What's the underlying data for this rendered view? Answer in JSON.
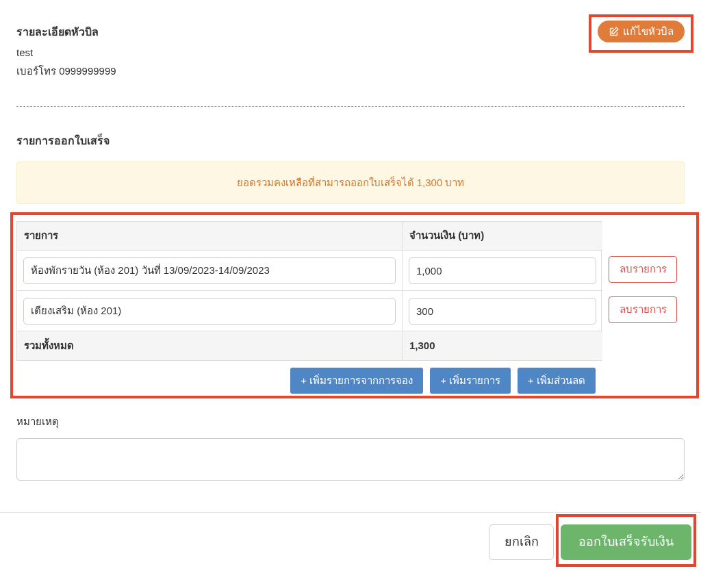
{
  "header": {
    "title": "รายละเอียดหัวบิล",
    "edit_button": {
      "label": "แก้ไขหัวบิล",
      "highlighted": true
    },
    "lines": [
      "test",
      "เบอร์โทร 0999999999"
    ]
  },
  "items_section": {
    "title": "รายการออกใบเสร็จ",
    "alert": "ยอดรวมคงเหลือที่สามารถออกใบเสร็จได้ 1,300 บาท",
    "highlighted": true,
    "columns": [
      "รายการ",
      "จำนวนเงิน (บาท)"
    ],
    "rows": [
      {
        "description": "ห้องพักรายวัน (ห้อง 201) วันที่ 13/09/2023-14/09/2023",
        "amount": "1,000",
        "delete_label": "ลบรายการ"
      },
      {
        "description": "เตียงเสริม (ห้อง 201)",
        "amount": "300",
        "delete_label": "ลบรายการ"
      }
    ],
    "total": {
      "label": "รวมทั้งหมด",
      "amount": "1,300"
    },
    "add_buttons": [
      "+ เพิ่มรายการจากการจอง",
      "+ เพิ่มรายการ",
      "+ เพิ่มส่วนลด"
    ]
  },
  "remarks": {
    "label": "หมายเหตุ"
  },
  "footer": {
    "cancel": "ยกเลิก",
    "submit": {
      "label": "ออกใบเสร็จรับเงิน",
      "highlighted": true
    }
  }
}
